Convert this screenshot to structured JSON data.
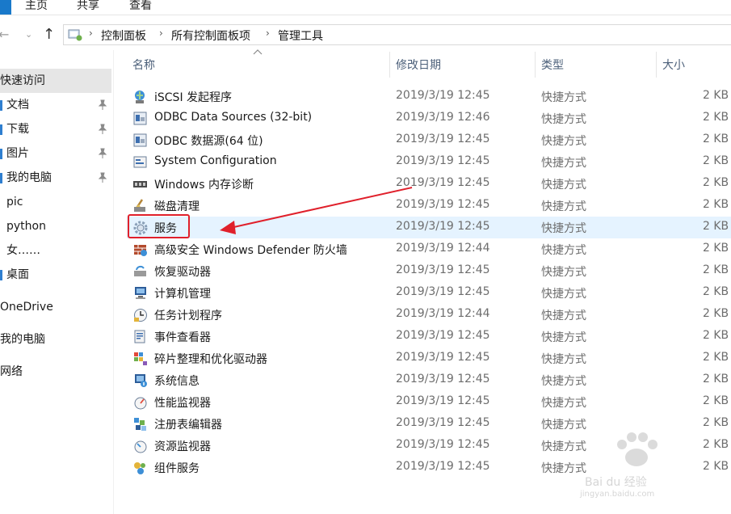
{
  "ribbon": {
    "tabs": [
      "主页",
      "共享",
      "查看"
    ]
  },
  "nav": {
    "back_glyph": "←",
    "forward_glyph": "→",
    "recent_glyph": "⌄",
    "up_glyph": "↑"
  },
  "address": {
    "separator": "›",
    "crumbs": [
      "控制面板",
      "所有控制面板项",
      "管理工具"
    ]
  },
  "sidebar": {
    "items": [
      {
        "label": "快速访问",
        "selected": true
      },
      {
        "label": "文档",
        "pinned": true,
        "icon": "documents-icon"
      },
      {
        "label": "下载",
        "pinned": true,
        "icon": "downloads-icon"
      },
      {
        "label": "图片",
        "pinned": true,
        "icon": "pictures-icon"
      },
      {
        "label": "我的电脑",
        "pinned": true,
        "icon": "computer-icon"
      },
      {
        "label": "pic"
      },
      {
        "label": "python"
      },
      {
        "label": "女……"
      },
      {
        "label": "桌面",
        "icon": "desktop-icon"
      },
      {
        "label": "OneDrive"
      },
      {
        "label": "我的电脑"
      },
      {
        "label": "网络"
      }
    ]
  },
  "columns": {
    "name": "名称",
    "date": "修改日期",
    "type": "类型",
    "size": "大小"
  },
  "files": [
    {
      "name": "iSCSI 发起程序",
      "date": "2019/3/19 12:45",
      "type": "快捷方式",
      "size": "2 KB",
      "icon": "iscsi-initiator-icon"
    },
    {
      "name": "ODBC Data Sources (32-bit)",
      "date": "2019/3/19 12:46",
      "type": "快捷方式",
      "size": "2 KB",
      "icon": "odbc-icon"
    },
    {
      "name": "ODBC 数据源(64 位)",
      "date": "2019/3/19 12:45",
      "type": "快捷方式",
      "size": "2 KB",
      "icon": "odbc-icon"
    },
    {
      "name": "System Configuration",
      "date": "2019/3/19 12:45",
      "type": "快捷方式",
      "size": "2 KB",
      "icon": "system-configuration-icon"
    },
    {
      "name": "Windows 内存诊断",
      "date": "2019/3/19 12:45",
      "type": "快捷方式",
      "size": "2 KB",
      "icon": "memory-diagnostic-icon"
    },
    {
      "name": "磁盘清理",
      "date": "2019/3/19 12:45",
      "type": "快捷方式",
      "size": "2 KB",
      "icon": "disk-cleanup-icon"
    },
    {
      "name": "服务",
      "date": "2019/3/19 12:45",
      "type": "快捷方式",
      "size": "2 KB",
      "icon": "services-gear-icon",
      "highlighted": true
    },
    {
      "name": "高级安全 Windows Defender 防火墙",
      "date": "2019/3/19 12:44",
      "type": "快捷方式",
      "size": "2 KB",
      "icon": "firewall-icon"
    },
    {
      "name": "恢复驱动器",
      "date": "2019/3/19 12:45",
      "type": "快捷方式",
      "size": "2 KB",
      "icon": "recovery-drive-icon"
    },
    {
      "name": "计算机管理",
      "date": "2019/3/19 12:45",
      "type": "快捷方式",
      "size": "2 KB",
      "icon": "computer-management-icon"
    },
    {
      "name": "任务计划程序",
      "date": "2019/3/19 12:44",
      "type": "快捷方式",
      "size": "2 KB",
      "icon": "task-scheduler-icon"
    },
    {
      "name": "事件查看器",
      "date": "2019/3/19 12:45",
      "type": "快捷方式",
      "size": "2 KB",
      "icon": "event-viewer-icon"
    },
    {
      "name": "碎片整理和优化驱动器",
      "date": "2019/3/19 12:45",
      "type": "快捷方式",
      "size": "2 KB",
      "icon": "defragment-icon"
    },
    {
      "name": "系统信息",
      "date": "2019/3/19 12:45",
      "type": "快捷方式",
      "size": "2 KB",
      "icon": "system-information-icon"
    },
    {
      "name": "性能监视器",
      "date": "2019/3/19 12:45",
      "type": "快捷方式",
      "size": "2 KB",
      "icon": "performance-monitor-icon"
    },
    {
      "name": "注册表编辑器",
      "date": "2019/3/19 12:45",
      "type": "快捷方式",
      "size": "2 KB",
      "icon": "registry-editor-icon"
    },
    {
      "name": "资源监视器",
      "date": "2019/3/19 12:45",
      "type": "快捷方式",
      "size": "2 KB",
      "icon": "resource-monitor-icon"
    },
    {
      "name": "组件服务",
      "date": "2019/3/19 12:45",
      "type": "快捷方式",
      "size": "2 KB",
      "icon": "component-services-icon"
    }
  ],
  "watermark": {
    "brand": "Bai du 经验",
    "url": "jingyan.baidu.com"
  },
  "colors": {
    "accent": "#1979ca",
    "selection": "#e5f3ff",
    "annotation_red": "#e0202b"
  }
}
